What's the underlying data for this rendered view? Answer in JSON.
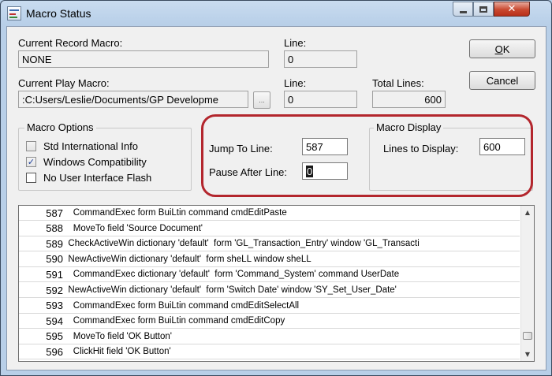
{
  "window": {
    "title": "Macro Status",
    "caption": {
      "minimize": "",
      "maximize": "",
      "close": "✕"
    }
  },
  "record": {
    "label": "Current Record Macro:",
    "value": "NONE",
    "line_label": "Line:",
    "line_value": "0"
  },
  "play": {
    "label": "Current Play Macro:",
    "value": ":C:Users/Leslie/Documents/GP Developme",
    "browse_label": "...",
    "line_label": "Line:",
    "line_value": "0",
    "total_label": "Total Lines:",
    "total_value": "600"
  },
  "buttons": {
    "ok": "OK",
    "cancel": "Cancel"
  },
  "macro_options": {
    "title": "Macro Options",
    "items": [
      {
        "label": "Std International Info",
        "checked": false
      },
      {
        "label": "Windows Compatibility",
        "checked": true
      },
      {
        "label": "No User Interface Flash",
        "checked": false
      }
    ]
  },
  "jump": {
    "jump_label": "Jump To Line:",
    "jump_value": "587",
    "pause_label": "Pause After Line:",
    "pause_value": "0"
  },
  "macro_display": {
    "title": "Macro Display",
    "lines_label": "Lines to Display:",
    "lines_value": "600"
  },
  "lines": [
    {
      "num": "587",
      "text": "    CommandExec form BuiLtin command cmdEditPaste"
    },
    {
      "num": "588",
      "text": "    MoveTo field 'Source Document'"
    },
    {
      "num": "589",
      "text": "  CheckActiveWin dictionary 'default'  form 'GL_Transaction_Entry' window 'GL_Transacti"
    },
    {
      "num": "590",
      "text": "  NewActiveWin dictionary 'default'  form sheLL window sheLL"
    },
    {
      "num": "591",
      "text": "    CommandExec dictionary 'default'  form 'Command_System' command UserDate"
    },
    {
      "num": "592",
      "text": "  NewActiveWin dictionary 'default'  form 'Switch Date' window 'SY_Set_User_Date'"
    },
    {
      "num": "593",
      "text": "    CommandExec form BuiLtin command cmdEditSelectAll"
    },
    {
      "num": "594",
      "text": "    CommandExec form BuiLtin command cmdEditCopy"
    },
    {
      "num": "595",
      "text": "    MoveTo field 'OK Button'"
    },
    {
      "num": "596",
      "text": "    ClickHit field 'OK Button'"
    }
  ],
  "scrollbar": {
    "up": "▲",
    "down": "▼"
  }
}
